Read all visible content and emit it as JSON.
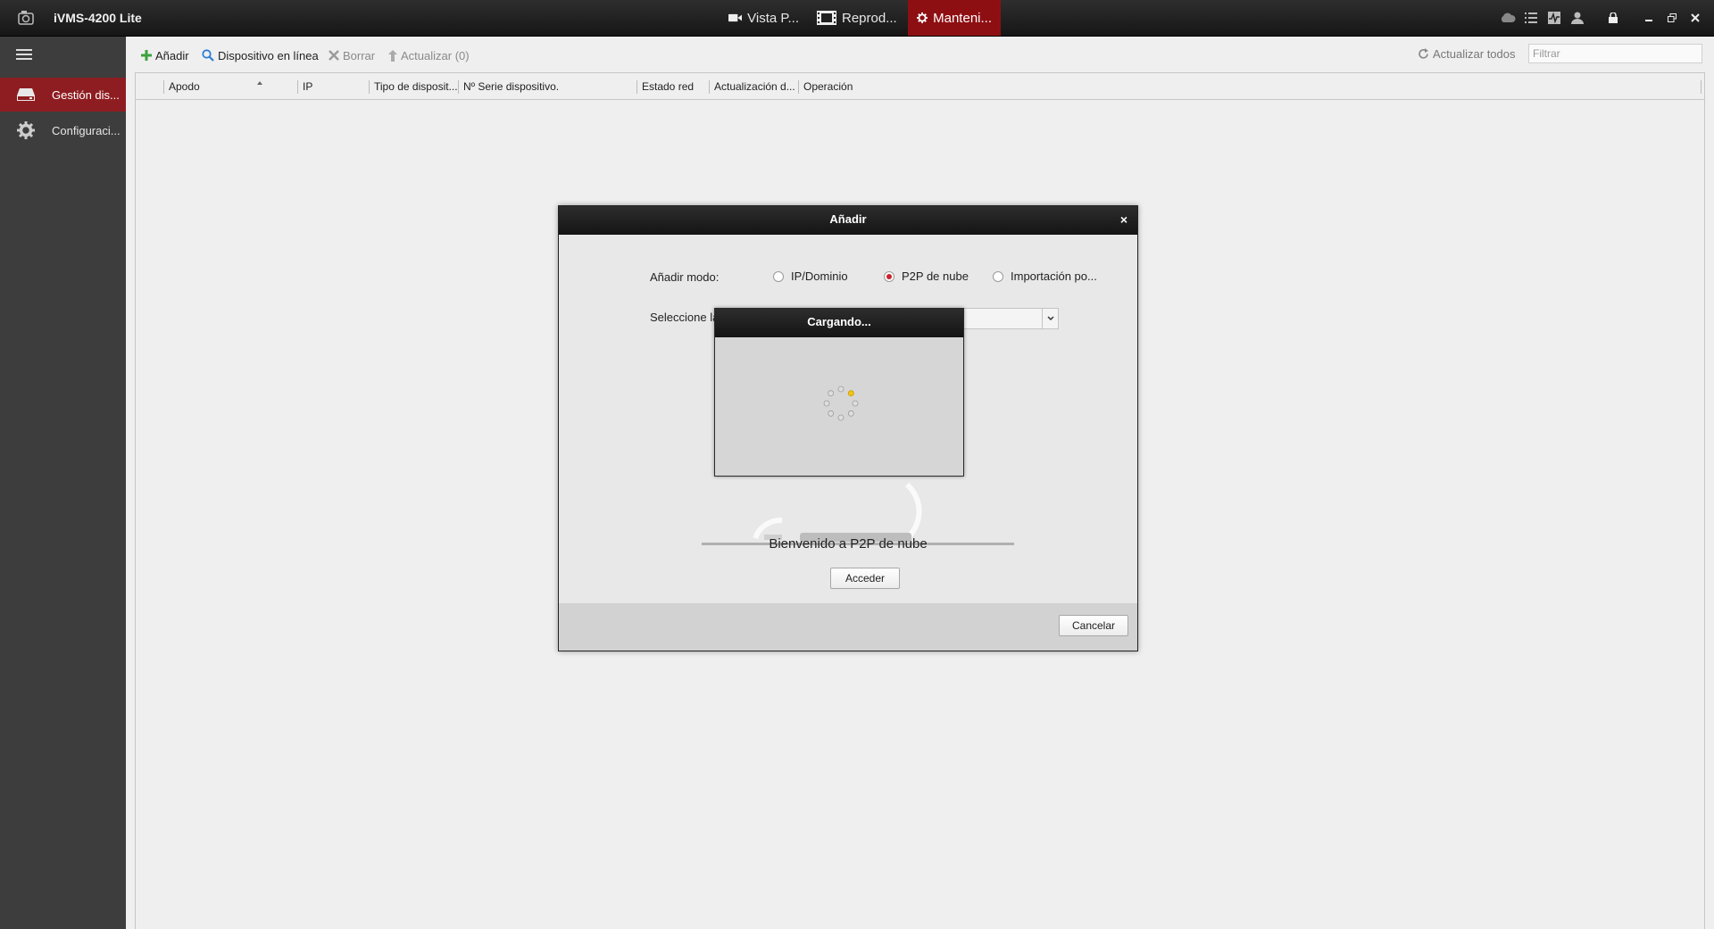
{
  "app": {
    "title": "iVMS-4200 Lite",
    "accent_color": "#8e0f12"
  },
  "tabs": [
    {
      "label": "Vista P...",
      "icon": "video-camera-icon"
    },
    {
      "label": "Reprod...",
      "icon": "film-icon"
    },
    {
      "label": "Manteni...",
      "icon": "gear-icon",
      "active": true
    }
  ],
  "system_icons": [
    "cloud-icon",
    "list-icon",
    "pulse-icon",
    "user-icon",
    "lock-icon",
    "minimize-icon",
    "restore-icon",
    "close-icon"
  ],
  "sidebar": {
    "items": [
      {
        "label": "Gestión dis...",
        "icon": "device-icon",
        "active": true
      },
      {
        "label": "Configuraci...",
        "icon": "gear-icon"
      }
    ]
  },
  "toolbar": {
    "add_label": "Añadir",
    "online_label": "Dispositivo en línea",
    "delete_label": "Borrar",
    "update_label": "Actualizar (0)",
    "refresh_all_label": "Actualizar todos",
    "filter_placeholder": "Filtrar"
  },
  "table": {
    "columns": [
      "Apodo",
      "IP",
      "Tipo de disposit...",
      "Nº Serie dispositivo.",
      "Estado red",
      "Actualización d...",
      "Operación"
    ],
    "rows": []
  },
  "dialog": {
    "title": "Añadir",
    "close_label": "×",
    "mode_label": "Añadir modo:",
    "modes": [
      {
        "label": "IP/Dominio",
        "selected": false
      },
      {
        "label": "P2P de nube",
        "selected": true
      },
      {
        "label": "Importación po...",
        "selected": false
      }
    ],
    "select_label": "Seleccione la",
    "welcome_text": "Bienvenido a P2P de nube",
    "login_label": "Acceder",
    "cancel_label": "Cancelar"
  },
  "loading": {
    "title": "Cargando..."
  }
}
